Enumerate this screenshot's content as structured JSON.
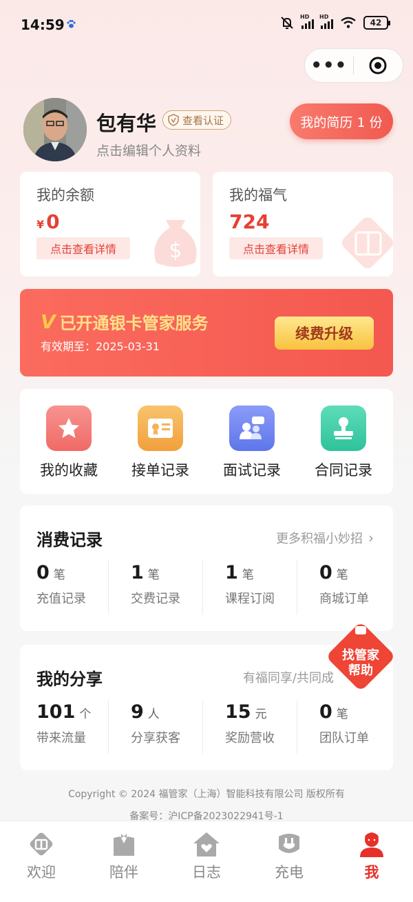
{
  "status_bar": {
    "time": "14:59",
    "battery": "42"
  },
  "profile": {
    "name": "包有华",
    "verify_label": "查看认证",
    "edit_hint": "点击编辑个人资料",
    "resume_label": "我的简历 1 份"
  },
  "balance": {
    "title": "我的余额",
    "currency": "¥",
    "value": "0",
    "detail_label": "点击查看详情"
  },
  "blessing": {
    "title": "我的福气",
    "value": "724",
    "detail_label": "点击查看详情"
  },
  "vip": {
    "mark": "V",
    "title": "已开通银卡管家服务",
    "expiry": "有效期至：2025-03-31",
    "renew_label": "续费升级"
  },
  "quick_links": [
    {
      "label": "我的收藏",
      "icon": "star-icon",
      "color": "#f47f7c"
    },
    {
      "label": "接单记录",
      "icon": "certificate-icon",
      "color": "#f5b257"
    },
    {
      "label": "面试记录",
      "icon": "people-chat-icon",
      "color": "#6d86f2"
    },
    {
      "label": "合同记录",
      "icon": "stamp-icon",
      "color": "#3ccfa8"
    }
  ],
  "consumption": {
    "title": "消费记录",
    "more": "更多积福小妙招",
    "stats": [
      {
        "num": "0",
        "unit": "笔",
        "label": "充值记录"
      },
      {
        "num": "1",
        "unit": "笔",
        "label": "交费记录"
      },
      {
        "num": "1",
        "unit": "笔",
        "label": "课程订阅"
      },
      {
        "num": "0",
        "unit": "笔",
        "label": "商城订单"
      }
    ]
  },
  "sharing": {
    "title": "我的分享",
    "more": "有福同享/共同成",
    "stats": [
      {
        "num": "101",
        "unit": "个",
        "label": "带来流量"
      },
      {
        "num": "9",
        "unit": "人",
        "label": "分享获客"
      },
      {
        "num": "15",
        "unit": "元",
        "label": "奖励营收"
      },
      {
        "num": "0",
        "unit": "笔",
        "label": "团队订单"
      }
    ]
  },
  "helper": {
    "line1": "找管家",
    "line2": "帮助"
  },
  "footer": {
    "copyright": "Copyright © 2024 福管家（上海）智能科技有限公司 版权所有",
    "icp": "备案号：沪ICP备2023022941号-1"
  },
  "tabs": [
    {
      "label": "欢迎",
      "icon": "blessing-icon",
      "active": false
    },
    {
      "label": "陪伴",
      "icon": "butler-icon",
      "active": false
    },
    {
      "label": "日志",
      "icon": "home-heart-icon",
      "active": false
    },
    {
      "label": "充电",
      "icon": "plug-icon",
      "active": false
    },
    {
      "label": "我",
      "icon": "user-icon",
      "active": true
    }
  ],
  "colors": {
    "accent": "#e6312a",
    "banner": "#f4584f",
    "gold": "#f8c23f"
  }
}
